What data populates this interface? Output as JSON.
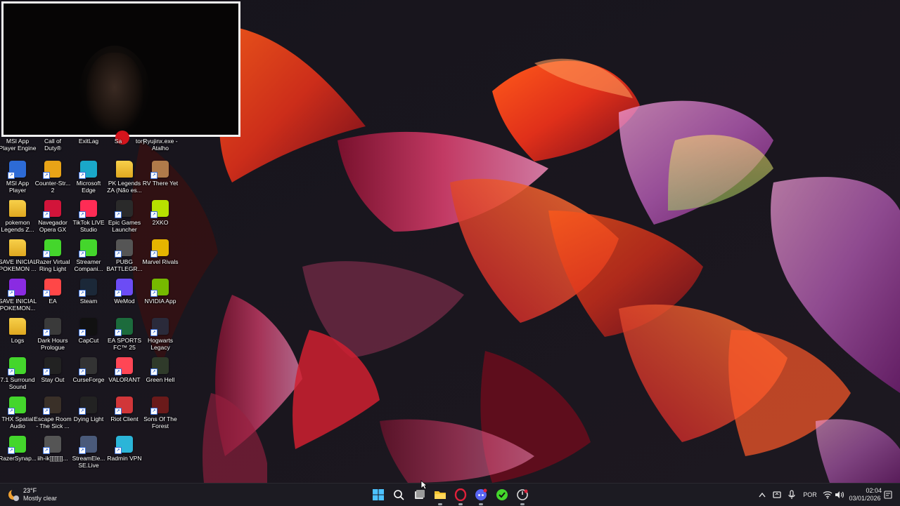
{
  "desktop": {
    "top_partial_labels": [
      "MSI App\nPlayer Engine",
      "Call of\nDuty®",
      "ExitLag",
      "Sa",
      "tory",
      "Ryujinx.exe -\nAtalho"
    ],
    "icons": [
      {
        "label": "MSI App Player",
        "icon": "msi-app-player-icon",
        "color": "#2d6bd6"
      },
      {
        "label": "Counter-Str... 2",
        "icon": "counter-strike-icon",
        "color": "#e8a317"
      },
      {
        "label": "Microsoft Edge",
        "icon": "edge-icon",
        "color": "#1aa8c9"
      },
      {
        "label": "PK Legends ZA (Não es...",
        "icon": "folder-icon",
        "color": "#f0c040"
      },
      {
        "label": "RV There Yet",
        "icon": "rv-there-yet-icon",
        "color": "#b07a4a"
      },
      {
        "label": "pokemon Legends Z...",
        "icon": "folder-icon",
        "color": "#f0c040"
      },
      {
        "label": "Navegador Opera GX",
        "icon": "opera-gx-icon",
        "color": "#d2143a"
      },
      {
        "label": "TikTok LIVE Studio",
        "icon": "tiktok-live-icon",
        "color": "#fe2c55"
      },
      {
        "label": "Epic Games Launcher",
        "icon": "epic-games-icon",
        "color": "#2a2a2a"
      },
      {
        "label": "2XKO",
        "icon": "2xko-icon",
        "color": "#b7e000"
      },
      {
        "label": "SAVE INICIAL POKEMON ...",
        "icon": "folder-icon",
        "color": "#f0c040"
      },
      {
        "label": "Razer Virtual Ring Light",
        "icon": "razer-ring-light-icon",
        "color": "#44d62c"
      },
      {
        "label": "Streamer Compani...",
        "icon": "razer-streamer-icon",
        "color": "#44d62c"
      },
      {
        "label": "PUBG BATTLEGR...",
        "icon": "pubg-icon",
        "color": "#555555"
      },
      {
        "label": "Marvel Rivals",
        "icon": "marvel-rivals-icon",
        "color": "#e5b400"
      },
      {
        "label": "SAVE INICIAL POKEMON...",
        "icon": "winrar-icon",
        "color": "#8a2be2"
      },
      {
        "label": "EA",
        "icon": "ea-icon",
        "color": "#ff4747"
      },
      {
        "label": "Steam",
        "icon": "steam-icon",
        "color": "#1b2838"
      },
      {
        "label": "WeMod",
        "icon": "wemod-icon",
        "color": "#6c4cf5"
      },
      {
        "label": "NVIDIA App",
        "icon": "nvidia-icon",
        "color": "#76b900"
      },
      {
        "label": "Logs",
        "icon": "folder-icon",
        "color": "#f0c040"
      },
      {
        "label": "Dark Hours Prologue",
        "icon": "dark-hours-icon",
        "color": "#3a3a3a"
      },
      {
        "label": "CapCut",
        "icon": "capcut-icon",
        "color": "#111111"
      },
      {
        "label": "EA SPORTS FC™ 25",
        "icon": "ea-fc-icon",
        "color": "#1c6b3c"
      },
      {
        "label": "Hogwarts Legacy",
        "icon": "hogwarts-icon",
        "color": "#2a2a3a"
      },
      {
        "label": "7.1 Surround Sound",
        "icon": "razer-surround-icon",
        "color": "#44d62c"
      },
      {
        "label": "Stay Out",
        "icon": "stay-out-icon",
        "color": "#222222"
      },
      {
        "label": "CurseForge",
        "icon": "curseforge-icon",
        "color": "#333333"
      },
      {
        "label": "VALORANT",
        "icon": "valorant-icon",
        "color": "#ff4655"
      },
      {
        "label": "Green Hell",
        "icon": "green-hell-icon",
        "color": "#2f3a2a"
      },
      {
        "label": "THX Spatial Audio",
        "icon": "thx-spatial-icon",
        "color": "#44d62c"
      },
      {
        "label": "Escape Room - The Sick ...",
        "icon": "escape-room-icon",
        "color": "#3a3028"
      },
      {
        "label": "Dying Light",
        "icon": "dying-light-icon",
        "color": "#222222"
      },
      {
        "label": "Riot Client",
        "icon": "riot-client-icon",
        "color": "#d13639"
      },
      {
        "label": "Sons Of The Forest",
        "icon": "sons-of-the-forest-icon",
        "color": "#6a1a1a"
      },
      {
        "label": "RazerSynap...",
        "icon": "razer-synapse-icon",
        "color": "#44d62c"
      },
      {
        "label": "iih-ik]]]]]]]]...",
        "icon": "game-icon",
        "color": "#555555"
      },
      {
        "label": "StreamEle... SE.Live",
        "icon": "streamelements-icon",
        "color": "#4a5a7a"
      },
      {
        "label": "Radmin VPN",
        "icon": "radmin-vpn-icon",
        "color": "#2bb5d8"
      }
    ]
  },
  "taskbar": {
    "weather": {
      "temp": "23°F",
      "desc": "Mostly clear"
    },
    "apps": [
      {
        "name": "start-button",
        "icon": "windows-icon",
        "running": false
      },
      {
        "name": "search-button",
        "icon": "search-icon",
        "running": false
      },
      {
        "name": "task-view-button",
        "icon": "task-view-icon",
        "running": false
      },
      {
        "name": "file-explorer-button",
        "icon": "folder-icon",
        "running": true
      },
      {
        "name": "opera-gx-button",
        "icon": "opera-gx-icon",
        "running": true
      },
      {
        "name": "discord-button",
        "icon": "discord-icon",
        "running": true
      },
      {
        "name": "razer-synapse-button",
        "icon": "razer-icon",
        "running": false
      },
      {
        "name": "razer-cortex-button",
        "icon": "razer-cortex-icon",
        "running": true
      }
    ],
    "tray": {
      "language": "POR",
      "time": "02:04",
      "date": "03/01/2026"
    }
  },
  "colors": {
    "accent": "#0a84ff",
    "taskbar_bg": "#1c1b22"
  }
}
